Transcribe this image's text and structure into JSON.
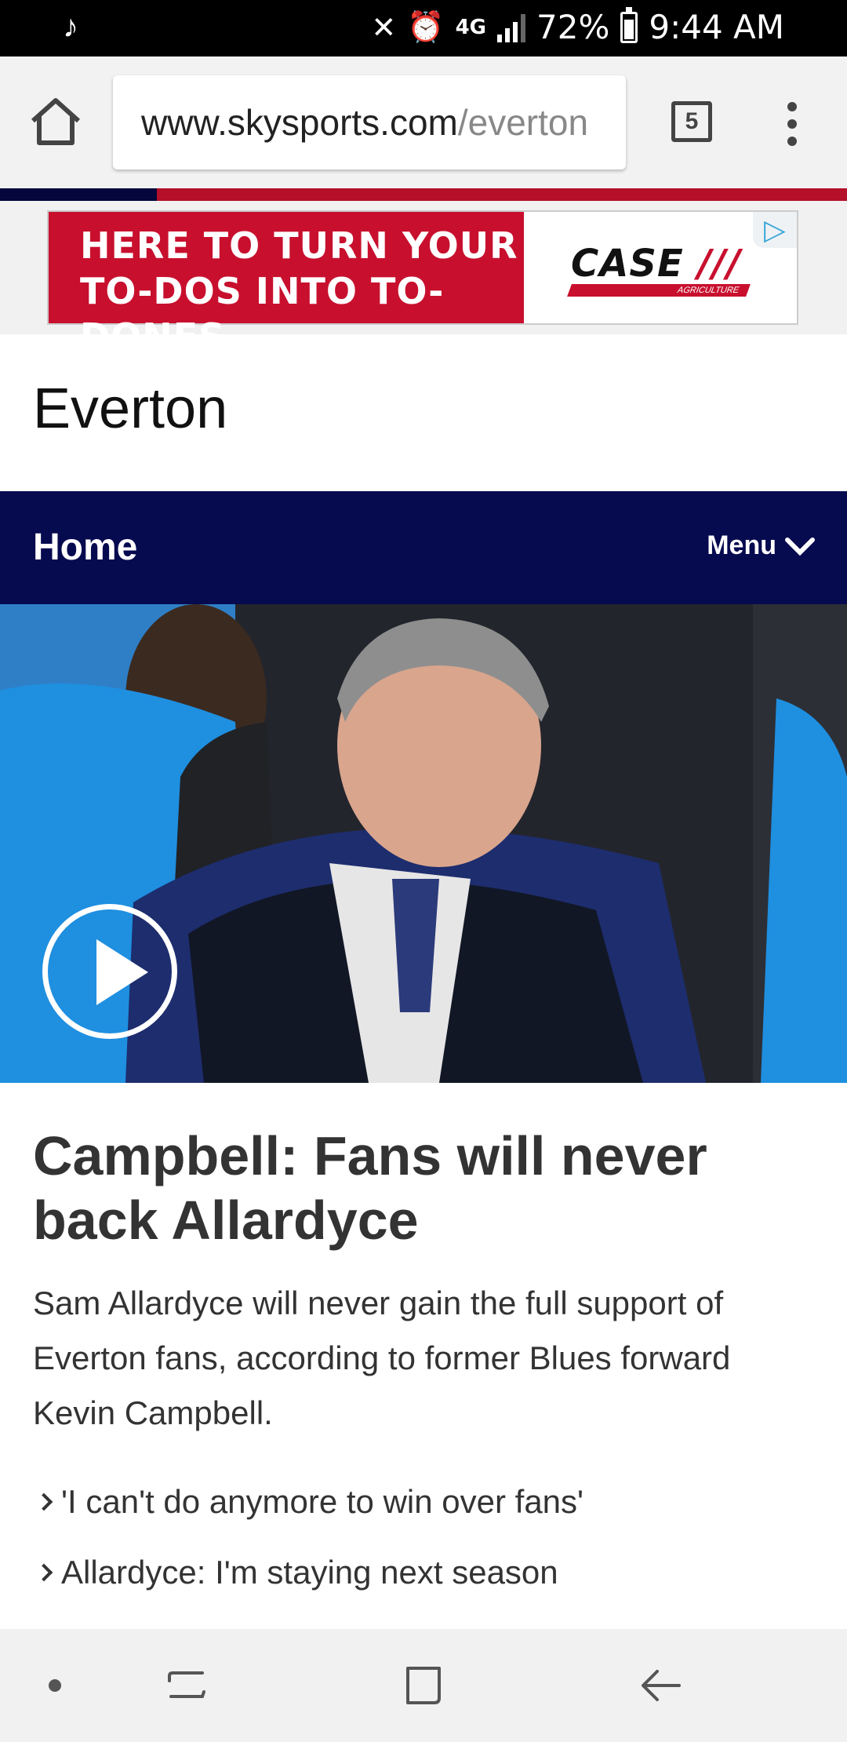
{
  "status_bar": {
    "notification_icon": "music-note-icon",
    "network": "4G",
    "battery": "72%",
    "time": "9:44 AM"
  },
  "browser": {
    "url_host": "www.skysports.com",
    "url_path": "/everton",
    "tab_count": "5"
  },
  "ad": {
    "line1": "HERE TO TURN YOUR",
    "line2": "TO-DOS INTO TO-DONES.",
    "brand": "CASE",
    "brand_sub": "AGRICULTURE",
    "colors": {
      "red": "#c8102e"
    }
  },
  "page": {
    "title": "Everton"
  },
  "nav": {
    "home": "Home",
    "menu": "Menu",
    "color": "#060a4f"
  },
  "article": {
    "headline": "Campbell: Fans will never back Allardyce",
    "summary": "Sam Allardyce will never gain the full support of Everton fans, according to former Blues forward Kevin Campbell.",
    "related": [
      "'I can't do anymore to win over fans'",
      "Allardyce: I'm staying next season"
    ]
  }
}
